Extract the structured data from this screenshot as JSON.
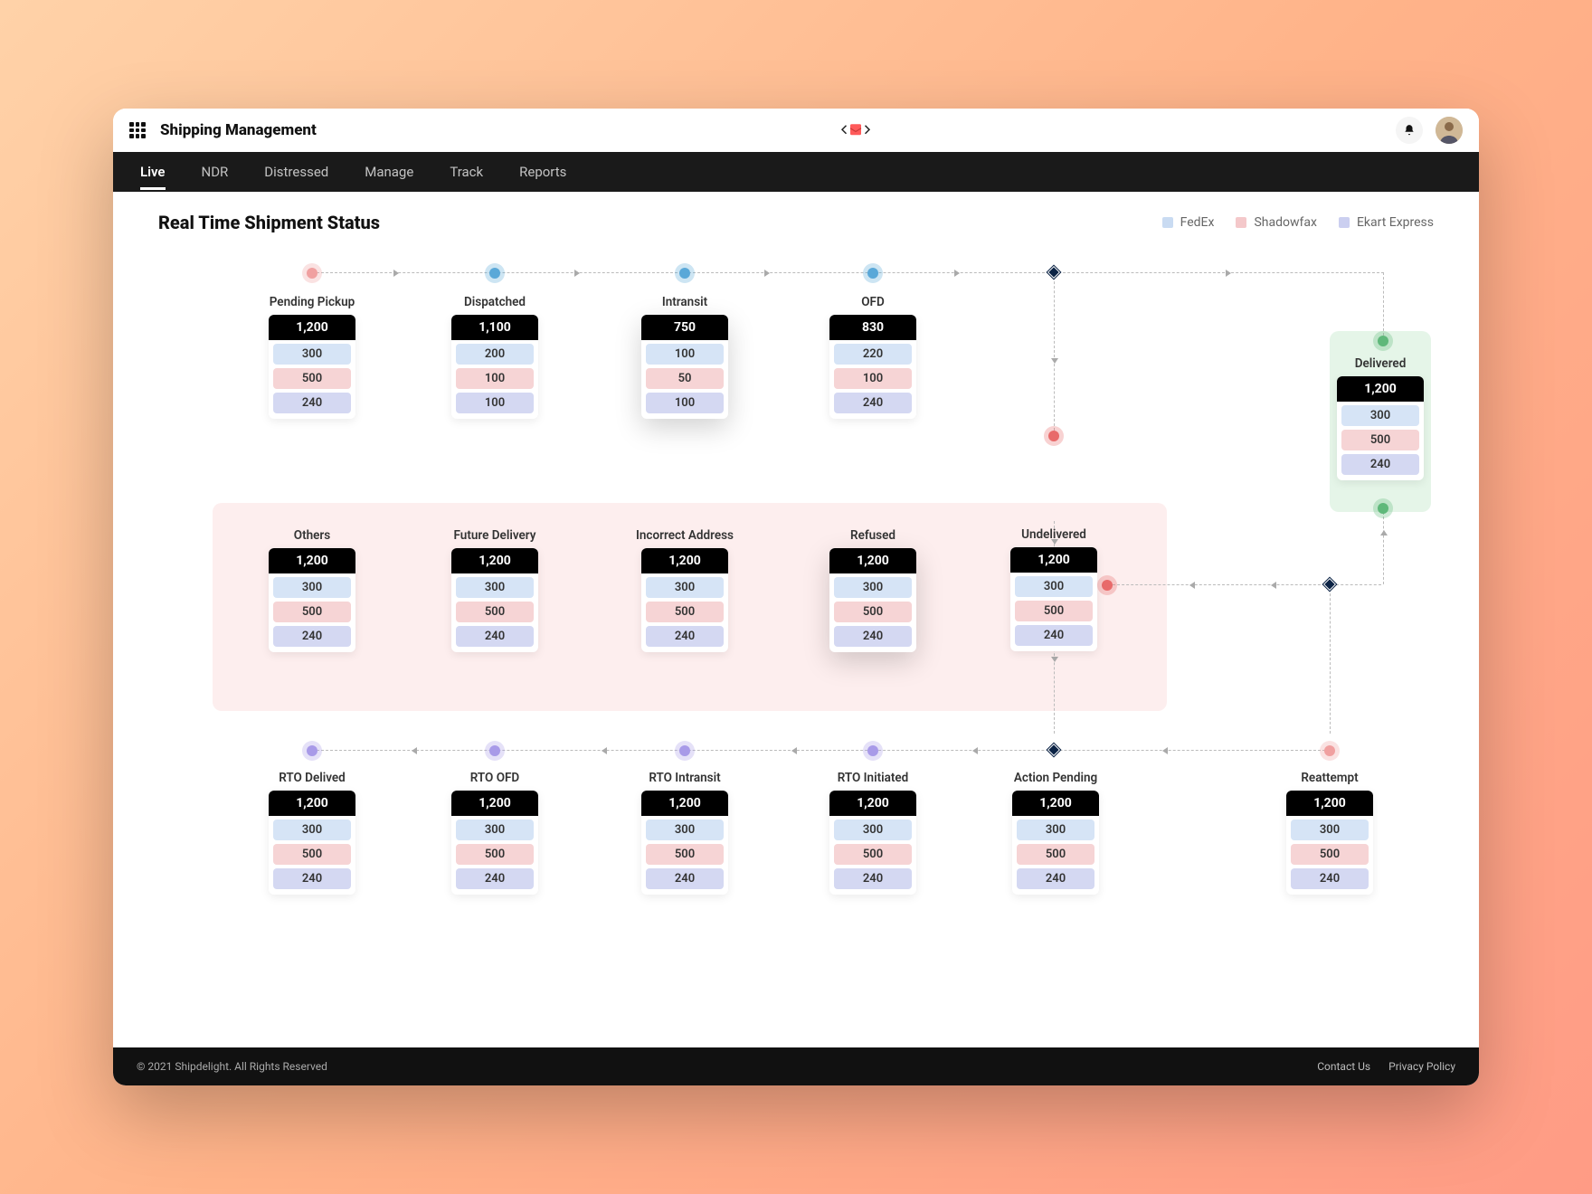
{
  "header": {
    "title": "Shipping Management"
  },
  "nav": [
    {
      "label": "Live",
      "active": true
    },
    {
      "label": "NDR",
      "active": false
    },
    {
      "label": "Distressed",
      "active": false
    },
    {
      "label": "Manage",
      "active": false
    },
    {
      "label": "Track",
      "active": false
    },
    {
      "label": "Reports",
      "active": false
    }
  ],
  "section_title": "Real Time Shipment Status",
  "legend": [
    {
      "name": "FedEx",
      "color": "#c9dbf2"
    },
    {
      "name": "Shadowfax",
      "color": "#f4c8ca"
    },
    {
      "name": "Ekart Express",
      "color": "#cbcff0"
    }
  ],
  "colors": {
    "fedex": "#d6e4f6",
    "shadowfax": "#f6d4d5",
    "ekart": "#d4d8f2"
  },
  "cards": {
    "pending_pickup": {
      "label": "Pending Pickup",
      "total": "1,200",
      "vals": [
        "300",
        "500",
        "240"
      ]
    },
    "dispatched": {
      "label": "Dispatched",
      "total": "1,100",
      "vals": [
        "200",
        "100",
        "100"
      ]
    },
    "intransit": {
      "label": "Intransit",
      "total": "750",
      "vals": [
        "100",
        "50",
        "100"
      ]
    },
    "ofd": {
      "label": "OFD",
      "total": "830",
      "vals": [
        "220",
        "100",
        "240"
      ]
    },
    "delivered": {
      "label": "Delivered",
      "total": "1,200",
      "vals": [
        "300",
        "500",
        "240"
      ]
    },
    "others": {
      "label": "Others",
      "total": "1,200",
      "vals": [
        "300",
        "500",
        "240"
      ]
    },
    "future_delivery": {
      "label": "Future Delivery",
      "total": "1,200",
      "vals": [
        "300",
        "500",
        "240"
      ]
    },
    "incorrect_address": {
      "label": "Incorrect Address",
      "total": "1,200",
      "vals": [
        "300",
        "500",
        "240"
      ]
    },
    "refused": {
      "label": "Refused",
      "total": "1,200",
      "vals": [
        "300",
        "500",
        "240"
      ]
    },
    "undelivered": {
      "label": "Undelivered",
      "total": "1,200",
      "vals": [
        "300",
        "500",
        "240"
      ]
    },
    "rto_delived": {
      "label": "RTO Delived",
      "total": "1,200",
      "vals": [
        "300",
        "500",
        "240"
      ]
    },
    "rto_ofd": {
      "label": "RTO OFD",
      "total": "1,200",
      "vals": [
        "300",
        "500",
        "240"
      ]
    },
    "rto_intransit": {
      "label": "RTO Intransit",
      "total": "1,200",
      "vals": [
        "300",
        "500",
        "240"
      ]
    },
    "rto_initiated": {
      "label": "RTO Initiated",
      "total": "1,200",
      "vals": [
        "300",
        "500",
        "240"
      ]
    },
    "action_pending": {
      "label": "Action Pending",
      "total": "1,200",
      "vals": [
        "300",
        "500",
        "240"
      ]
    },
    "reattempt": {
      "label": "Reattempt",
      "total": "1,200",
      "vals": [
        "300",
        "500",
        "240"
      ]
    }
  },
  "footer": {
    "copyright": "© 2021 Shipdelight. All Rights Reserved",
    "links": [
      "Contact Us",
      "Privacy Policy"
    ]
  }
}
